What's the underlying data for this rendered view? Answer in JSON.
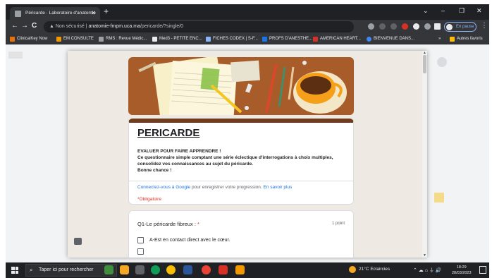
{
  "browser": {
    "tab_title": "Péricarde · Laboratoire d'anatomie",
    "tab_close": "✕",
    "new_tab": "+",
    "window_controls": {
      "dropdown": "⌄",
      "minimize": "–",
      "maximize": "❐",
      "close": "✕"
    },
    "nav": {
      "back": "←",
      "forward": "→",
      "reload": "C"
    },
    "security_warning": "Non sécurisé",
    "url_host": "anatomie-fmpm.uca.ma",
    "url_path": "/pericarde/?single/0",
    "profile_label": "En pause",
    "menu_icon": "⋮"
  },
  "bookmarks": [
    {
      "label": "ClinicalKey Now",
      "color": "#e8710a"
    },
    {
      "label": "EM CONSULTE",
      "color": "#f29900"
    },
    {
      "label": "RMS : Revue Médic...",
      "color": "#9aa0a6"
    },
    {
      "label": "Med3 - PETITE ENC...",
      "color": "#e8eaed"
    },
    {
      "label": "FICHES CODEX | S-F...",
      "color": "#8ab4f8"
    },
    {
      "label": "PROFS D'ANESTHE...",
      "color": "#1a73e8"
    },
    {
      "label": "AMERICAN HEART...",
      "color": "#d93025"
    },
    {
      "label": "BIENVENUE DANS...",
      "color": "#4285f4"
    }
  ],
  "bookmarks_more": "»",
  "bookmarks_other": "Autres favoris",
  "form": {
    "title": "PERICARDE",
    "description": "EVALUER POUR FAIRE APPRENDRE !\nCe questionnaire simple comptant une série éclectique d'interrogations à choix multiples, consolidez vos connaissances au sujet du péricarde.\nBonne chance !",
    "signin_link": "Connectez-vous à Google",
    "signin_text": " pour enregistrer votre progression. ",
    "learn_more": "En savoir plus",
    "required_note": "*Obligatoire",
    "accent_color": "#6f3d1e",
    "question": {
      "title": "Q1-Le péricarde fibreux :",
      "required_mark": " *",
      "points": "1 point",
      "options": [
        "A-Est en contact direct avec le cœur."
      ]
    }
  },
  "taskbar": {
    "search_placeholder": "Taper ici pour rechercher",
    "weather": "21°C  Eclaircies",
    "tray_icons": "⌃ ☁ ⌂ ⏚ 🔊",
    "time": "18:29",
    "date": "28/03/2023"
  }
}
